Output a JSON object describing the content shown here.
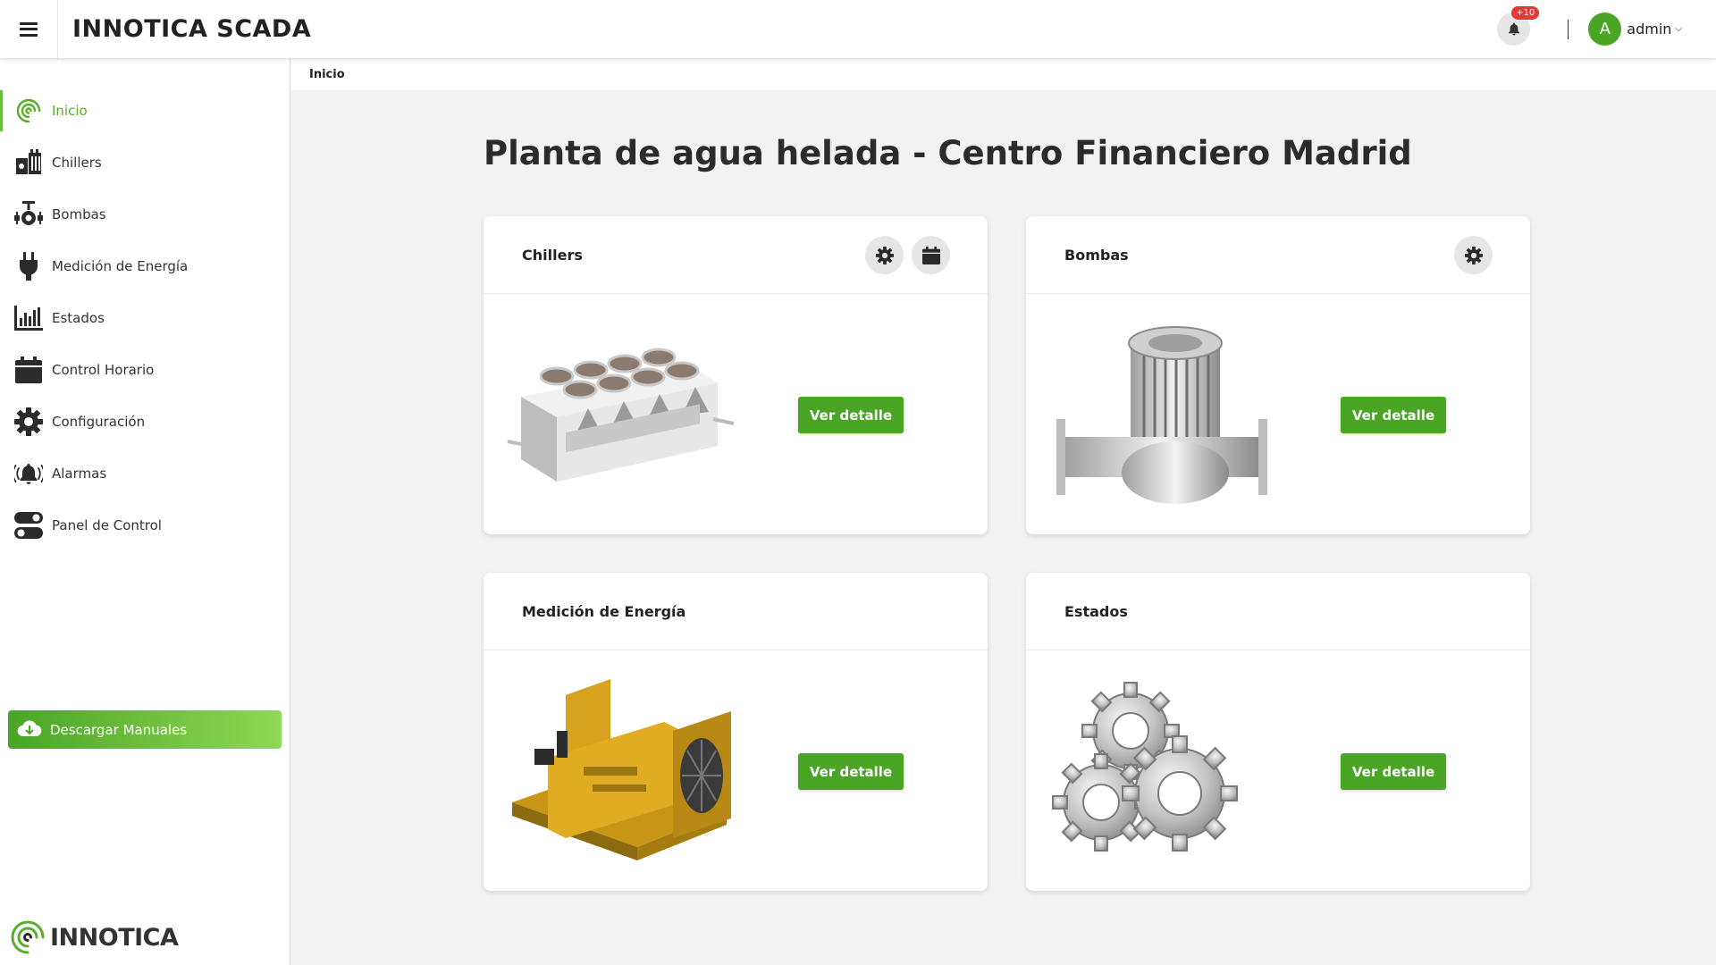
{
  "header": {
    "brand": "INNOTICA SCADA",
    "notification_badge": "+10",
    "user": {
      "avatar_letter": "A",
      "name": "admin"
    }
  },
  "sidebar": {
    "items": [
      {
        "label": "Inicio",
        "icon": "inicio-spiral-icon",
        "active": true
      },
      {
        "label": "Chillers",
        "icon": "chiller-icon"
      },
      {
        "label": "Bombas",
        "icon": "pump-icon"
      },
      {
        "label": "Medición de Energía",
        "icon": "plug-icon"
      },
      {
        "label": "Estados",
        "icon": "bar-chart-icon"
      },
      {
        "label": "Control Horario",
        "icon": "calendar-icon"
      },
      {
        "label": "Configuración",
        "icon": "gear-icon"
      },
      {
        "label": "Alarmas",
        "icon": "alarm-bell-icon"
      },
      {
        "label": "Panel de Control",
        "icon": "toggle-icon"
      }
    ],
    "download_label": "Descargar Manuales",
    "logo_text": "INNOTICA"
  },
  "breadcrumb": "Inicio",
  "page_title": "Planta de agua helada - Centro Financiero Madrid",
  "cards": [
    {
      "title": "Chillers",
      "button": "Ver detalle",
      "actions": [
        "gear-icon",
        "calendar-icon"
      ],
      "image": "chiller-unit"
    },
    {
      "title": "Bombas",
      "button": "Ver detalle",
      "actions": [
        "gear-icon"
      ],
      "image": "pump-unit"
    },
    {
      "title": "Medición de Energía",
      "button": "Ver detalle",
      "actions": [],
      "image": "generator-unit"
    },
    {
      "title": "Estados",
      "button": "Ver detalle",
      "actions": [],
      "image": "gears"
    }
  ],
  "colors": {
    "accent": "#4aa525",
    "accent_light": "#8fd855",
    "badge": "#e53935"
  }
}
